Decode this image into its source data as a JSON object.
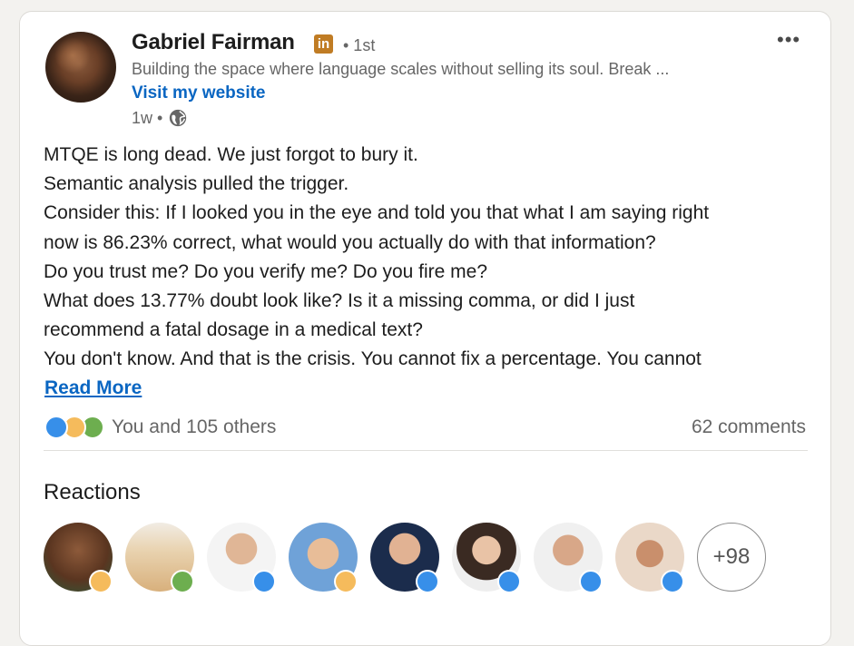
{
  "author": {
    "name": "Gabriel Fairman",
    "badge_text": "in",
    "degree": "• 1st",
    "headline": "Building the space where language scales without selling its soul. Break ...",
    "website_link": "Visit my website",
    "time": "1w •",
    "avatar_icon": "user-avatar"
  },
  "menu": {
    "more_label": "•••"
  },
  "post": {
    "lines": [
      "MTQE is long dead. We just forgot to bury it.",
      "Semantic analysis pulled the trigger.",
      "Consider this: If I looked you in the eye and told you that what I am saying right",
      "now is 86.23% correct, what would you actually do with that information?",
      "Do you trust me? Do you verify me? Do you fire me?",
      "What does 13.77% doubt look like? Is it a missing comma, or did I just",
      "recommend a fatal dosage in a medical text?",
      "You don't know. And that is the crisis. You cannot fix a percentage. You cannot"
    ],
    "read_more": "Read More"
  },
  "social": {
    "reactions_text": "You and 105 others",
    "comments_text": "62 comments",
    "reaction_icons": [
      "like-icon",
      "insight-icon",
      "support-icon"
    ]
  },
  "reactions": {
    "heading": "Reactions",
    "more_count": "+98",
    "reactors": [
      {
        "reaction": "insight"
      },
      {
        "reaction": "support"
      },
      {
        "reaction": "like"
      },
      {
        "reaction": "insight"
      },
      {
        "reaction": "like"
      },
      {
        "reaction": "like"
      },
      {
        "reaction": "like"
      },
      {
        "reaction": "like"
      }
    ]
  },
  "colors": {
    "link": "#0a66c2",
    "like": "#378fe9",
    "insight": "#f5bb5c",
    "support": "#6dae4f",
    "badge": "#c07c24"
  }
}
